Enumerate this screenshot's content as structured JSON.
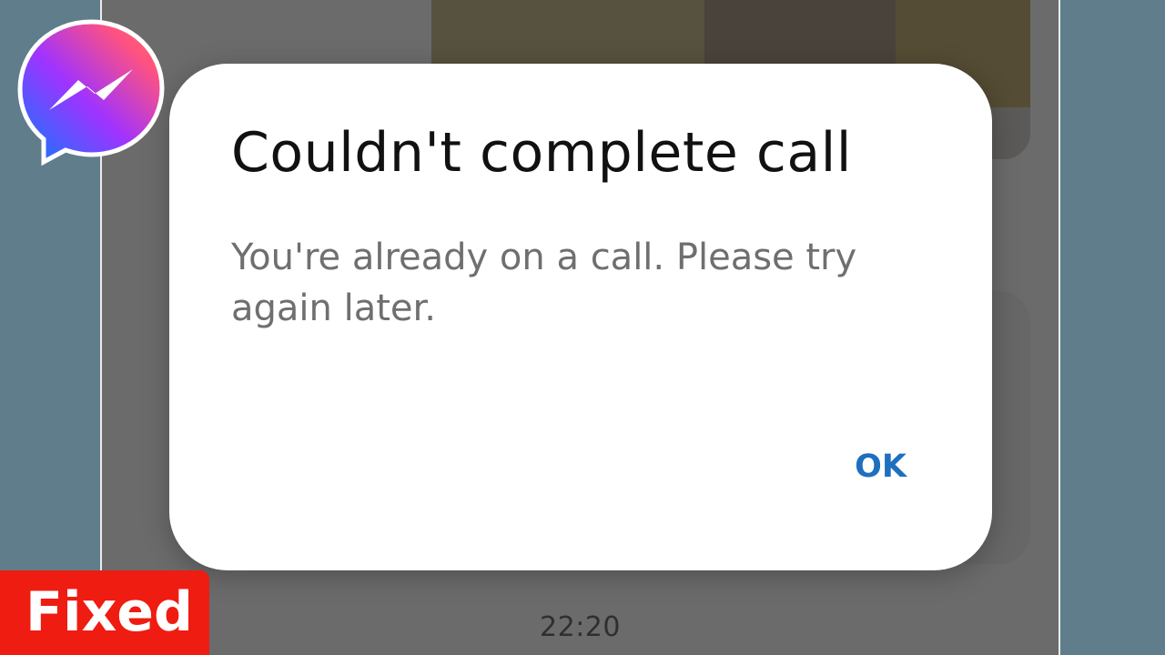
{
  "dialog": {
    "title": "Couldn't complete call",
    "message": "You're already on a call. Please try again later.",
    "ok_label": "OK"
  },
  "chat": {
    "timestamp": "22:20"
  },
  "badge": {
    "label": "Fixed"
  },
  "logo": {
    "icon": "messenger-logo-icon"
  },
  "colors": {
    "accent": "#1f6fbf",
    "badge": "#ef1c12",
    "background": "#5f7d8b"
  }
}
